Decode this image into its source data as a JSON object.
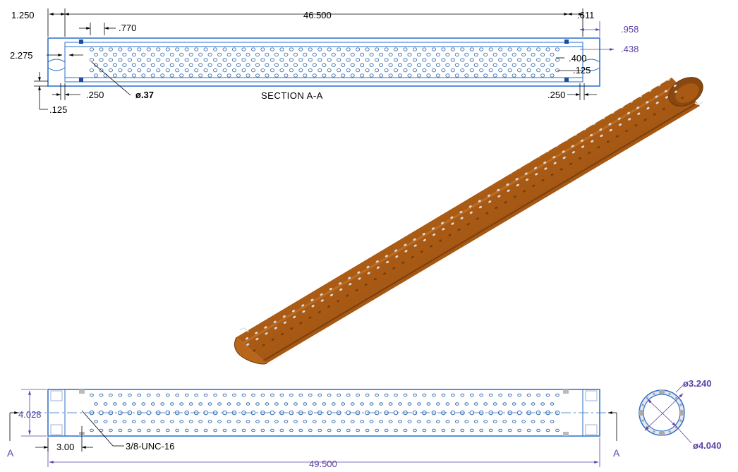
{
  "section_view": {
    "title": "SECTION  A-A",
    "dims": {
      "overall_length": "46.500",
      "left_offset": "1.250",
      "hole_pitch": ".770",
      "height": "2.275",
      "hole_diameter": "ø.37",
      "slot_left": ".250",
      "slot_left_small": ".125",
      "slot_right": ".250",
      "right_offset": ".611",
      "right_958": ".958",
      "right_438": ".438",
      "right_400": ".400",
      "right_125": ".125"
    }
  },
  "iso_view": {
    "name": "perforated-tube-3d"
  },
  "front_view": {
    "dims": {
      "overall_length": "49.500",
      "height": "4.028",
      "end_offset": "3.00",
      "thread_callout": "3/8-UNC-16",
      "section_marker_left": "A",
      "section_marker_right": "A"
    }
  },
  "end_view": {
    "dims": {
      "inner_diameter": "ø3.240",
      "outer_diameter": "ø4.040"
    }
  },
  "colors": {
    "tube_brown": "#a85a14",
    "tube_dark": "#7a3e0a",
    "hole_blue": "#3a6fb0",
    "dim_purple": "#5b3fa3",
    "line_black": "#000000"
  }
}
